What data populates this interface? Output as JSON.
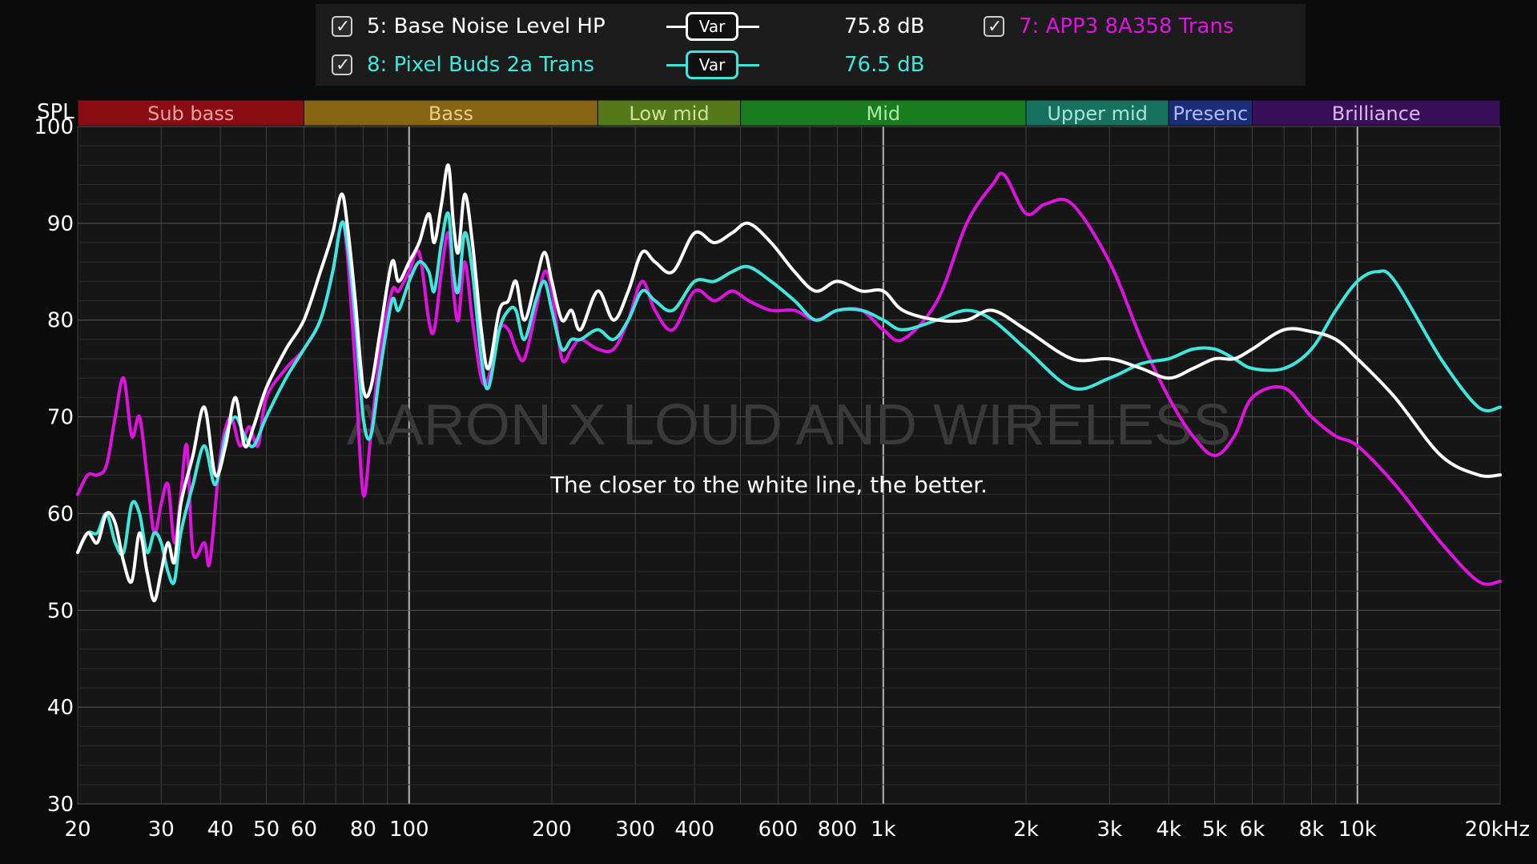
{
  "legend": {
    "entries": [
      {
        "label": "5: Base Noise Level HP",
        "value": "75.8 dB",
        "color": "#ffffff",
        "btn": "Var"
      },
      {
        "label": "8: Pixel Buds 2a Trans",
        "value": "76.5 dB",
        "color": "#3ee6dc",
        "btn": "Var"
      },
      {
        "label": "7: APP3 8A358 Trans",
        "color": "#e012e0"
      }
    ]
  },
  "bands": [
    {
      "label": "Sub bass",
      "from": 20,
      "to": 60,
      "color": "#8a0d14",
      "text": "#e7a1a6"
    },
    {
      "label": "Bass",
      "from": 60,
      "to": 250,
      "color": "#866414",
      "text": "#e6cf8a"
    },
    {
      "label": "Low mid",
      "from": 250,
      "to": 500,
      "color": "#55781a",
      "text": "#c8e39a"
    },
    {
      "label": "Mid",
      "from": 500,
      "to": 2000,
      "color": "#1a7d1f",
      "text": "#a9eaa9"
    },
    {
      "label": "Upper mid",
      "from": 2000,
      "to": 4000,
      "color": "#17715f",
      "text": "#a9e4d6"
    },
    {
      "label": "Presenc",
      "from": 4000,
      "to": 6000,
      "color": "#1b2c78",
      "text": "#b0bcf5"
    },
    {
      "label": "Brilliance",
      "from": 6000,
      "to": 20000,
      "color": "#3a0f5a",
      "text": "#d8b8f0"
    }
  ],
  "watermark": "AARON X LOUD AND WIRELESS",
  "annotation": "The closer to the white line, the better.",
  "chart_data": {
    "type": "line",
    "xscale": "log",
    "xlim": [
      20,
      20000
    ],
    "ylim": [
      30,
      100
    ],
    "ylabel": "SPL",
    "xunit": "Hz",
    "grid": true,
    "yticks": [
      30,
      40,
      50,
      60,
      70,
      80,
      90,
      100
    ],
    "xticks": [
      {
        "v": 20,
        "l": "20"
      },
      {
        "v": 30,
        "l": "30"
      },
      {
        "v": 40,
        "l": "40"
      },
      {
        "v": 50,
        "l": "50"
      },
      {
        "v": 60,
        "l": "60"
      },
      {
        "v": 80,
        "l": "80"
      },
      {
        "v": 100,
        "l": "100"
      },
      {
        "v": 200,
        "l": "200"
      },
      {
        "v": 300,
        "l": "300"
      },
      {
        "v": 400,
        "l": "400"
      },
      {
        "v": 600,
        "l": "600"
      },
      {
        "v": 800,
        "l": "800"
      },
      {
        "v": 1000,
        "l": "1k"
      },
      {
        "v": 2000,
        "l": "2k"
      },
      {
        "v": 3000,
        "l": "3k"
      },
      {
        "v": 4000,
        "l": "4k"
      },
      {
        "v": 5000,
        "l": "5k"
      },
      {
        "v": 6000,
        "l": "6k"
      },
      {
        "v": 8000,
        "l": "8k"
      },
      {
        "v": 10000,
        "l": "10k"
      },
      {
        "v": 20000,
        "l": "20kHz"
      }
    ],
    "series": [
      {
        "name": "5: Base Noise Level HP",
        "color": "#ffffff",
        "points": [
          [
            20,
            56
          ],
          [
            21,
            58
          ],
          [
            22,
            57
          ],
          [
            23,
            60
          ],
          [
            24,
            59
          ],
          [
            25,
            55
          ],
          [
            26,
            53
          ],
          [
            27,
            58
          ],
          [
            28,
            54
          ],
          [
            29,
            51
          ],
          [
            30,
            54
          ],
          [
            31,
            57
          ],
          [
            32,
            55
          ],
          [
            33,
            61
          ],
          [
            35,
            66
          ],
          [
            37,
            71
          ],
          [
            39,
            64
          ],
          [
            41,
            67
          ],
          [
            43,
            72
          ],
          [
            45,
            67
          ],
          [
            47,
            69
          ],
          [
            50,
            73
          ],
          [
            55,
            77
          ],
          [
            60,
            80
          ],
          [
            65,
            85
          ],
          [
            69,
            89
          ],
          [
            72,
            93
          ],
          [
            74,
            90
          ],
          [
            77,
            82
          ],
          [
            80,
            73
          ],
          [
            83,
            73
          ],
          [
            87,
            79
          ],
          [
            92,
            86
          ],
          [
            95,
            84
          ],
          [
            100,
            86
          ],
          [
            105,
            88
          ],
          [
            110,
            91
          ],
          [
            113,
            88
          ],
          [
            117,
            92
          ],
          [
            121,
            96
          ],
          [
            124,
            90
          ],
          [
            127,
            87
          ],
          [
            131,
            93
          ],
          [
            136,
            88
          ],
          [
            142,
            79
          ],
          [
            147,
            75
          ],
          [
            155,
            81
          ],
          [
            162,
            82
          ],
          [
            168,
            84
          ],
          [
            175,
            80
          ],
          [
            185,
            84
          ],
          [
            193,
            87
          ],
          [
            200,
            84
          ],
          [
            210,
            80
          ],
          [
            220,
            81
          ],
          [
            230,
            79
          ],
          [
            250,
            83
          ],
          [
            270,
            80
          ],
          [
            290,
            83
          ],
          [
            310,
            87
          ],
          [
            330,
            86
          ],
          [
            360,
            85
          ],
          [
            400,
            89
          ],
          [
            440,
            88
          ],
          [
            480,
            89
          ],
          [
            520,
            90
          ],
          [
            580,
            88
          ],
          [
            650,
            85
          ],
          [
            720,
            83
          ],
          [
            800,
            84
          ],
          [
            900,
            83
          ],
          [
            1000,
            83
          ],
          [
            1100,
            81
          ],
          [
            1300,
            80
          ],
          [
            1500,
            80
          ],
          [
            1700,
            81
          ],
          [
            2000,
            79
          ],
          [
            2500,
            76
          ],
          [
            3000,
            76
          ],
          [
            3500,
            75
          ],
          [
            4000,
            74
          ],
          [
            4500,
            75
          ],
          [
            5000,
            76
          ],
          [
            5500,
            76
          ],
          [
            6000,
            77
          ],
          [
            7000,
            79
          ],
          [
            8000,
            78.8
          ],
          [
            9000,
            78
          ],
          [
            10000,
            76
          ],
          [
            12000,
            72
          ],
          [
            15000,
            66
          ],
          [
            18000,
            64
          ],
          [
            20000,
            64
          ]
        ]
      },
      {
        "name": "8: Pixel Buds 2a Trans",
        "color": "#3ee6dc",
        "points": [
          [
            20,
            56
          ],
          [
            21,
            58
          ],
          [
            22,
            58
          ],
          [
            23,
            60
          ],
          [
            24,
            57
          ],
          [
            25,
            56
          ],
          [
            26,
            61
          ],
          [
            27,
            60
          ],
          [
            28,
            56
          ],
          [
            29,
            58
          ],
          [
            30,
            57
          ],
          [
            31,
            54
          ],
          [
            32,
            53
          ],
          [
            33,
            58
          ],
          [
            35,
            63
          ],
          [
            37,
            67
          ],
          [
            39,
            63
          ],
          [
            41,
            68
          ],
          [
            43,
            70
          ],
          [
            45,
            68
          ],
          [
            47,
            67
          ],
          [
            50,
            70
          ],
          [
            55,
            74
          ],
          [
            60,
            77
          ],
          [
            65,
            80
          ],
          [
            69,
            85
          ],
          [
            72,
            90
          ],
          [
            74,
            88
          ],
          [
            77,
            80
          ],
          [
            80,
            70
          ],
          [
            83,
            68
          ],
          [
            87,
            75
          ],
          [
            92,
            82
          ],
          [
            95,
            81
          ],
          [
            100,
            84
          ],
          [
            105,
            86
          ],
          [
            110,
            85
          ],
          [
            113,
            83
          ],
          [
            117,
            88
          ],
          [
            121,
            91
          ],
          [
            124,
            85
          ],
          [
            127,
            83
          ],
          [
            131,
            89
          ],
          [
            136,
            85
          ],
          [
            142,
            76
          ],
          [
            147,
            73
          ],
          [
            155,
            79
          ],
          [
            162,
            81
          ],
          [
            168,
            81
          ],
          [
            175,
            78
          ],
          [
            185,
            82
          ],
          [
            193,
            84
          ],
          [
            200,
            81
          ],
          [
            210,
            77
          ],
          [
            220,
            78
          ],
          [
            230,
            78
          ],
          [
            250,
            79
          ],
          [
            270,
            78
          ],
          [
            290,
            80
          ],
          [
            310,
            83
          ],
          [
            330,
            82
          ],
          [
            360,
            81
          ],
          [
            400,
            84
          ],
          [
            440,
            84
          ],
          [
            480,
            85
          ],
          [
            520,
            85.5
          ],
          [
            580,
            84
          ],
          [
            650,
            82
          ],
          [
            720,
            80
          ],
          [
            800,
            81
          ],
          [
            900,
            81
          ],
          [
            1000,
            80
          ],
          [
            1100,
            79
          ],
          [
            1300,
            80
          ],
          [
            1500,
            81
          ],
          [
            1700,
            80
          ],
          [
            2000,
            77
          ],
          [
            2500,
            73
          ],
          [
            3000,
            74
          ],
          [
            3500,
            75.5
          ],
          [
            4000,
            76
          ],
          [
            4500,
            77
          ],
          [
            5000,
            77
          ],
          [
            5500,
            76
          ],
          [
            6000,
            75
          ],
          [
            7000,
            75
          ],
          [
            8000,
            77
          ],
          [
            9000,
            81
          ],
          [
            10000,
            84
          ],
          [
            11000,
            85
          ],
          [
            12000,
            84
          ],
          [
            15000,
            76
          ],
          [
            18000,
            71
          ],
          [
            20000,
            71
          ]
        ]
      },
      {
        "name": "7: APP3 8A358 Trans",
        "color": "#e012e0",
        "points": [
          [
            20,
            62
          ],
          [
            21,
            64
          ],
          [
            22,
            64
          ],
          [
            23,
            65
          ],
          [
            24,
            70
          ],
          [
            25,
            74
          ],
          [
            26,
            68
          ],
          [
            27,
            70
          ],
          [
            28,
            64
          ],
          [
            29,
            58
          ],
          [
            30,
            61
          ],
          [
            31,
            63
          ],
          [
            32,
            57
          ],
          [
            33,
            62
          ],
          [
            34,
            67
          ],
          [
            35,
            56
          ],
          [
            37,
            57
          ],
          [
            38,
            55
          ],
          [
            40,
            66
          ],
          [
            42,
            70
          ],
          [
            44,
            67
          ],
          [
            46,
            69
          ],
          [
            48,
            67
          ],
          [
            50,
            72
          ],
          [
            55,
            75
          ],
          [
            60,
            77
          ],
          [
            65,
            80
          ],
          [
            69,
            85
          ],
          [
            72,
            90
          ],
          [
            74,
            87
          ],
          [
            77,
            75
          ],
          [
            80,
            62
          ],
          [
            83,
            68
          ],
          [
            87,
            77
          ],
          [
            92,
            83
          ],
          [
            95,
            83
          ],
          [
            100,
            85
          ],
          [
            105,
            87
          ],
          [
            110,
            80
          ],
          [
            113,
            79
          ],
          [
            117,
            85
          ],
          [
            121,
            89
          ],
          [
            124,
            83
          ],
          [
            127,
            80
          ],
          [
            131,
            86
          ],
          [
            136,
            80
          ],
          [
            142,
            74
          ],
          [
            147,
            74
          ],
          [
            155,
            79
          ],
          [
            162,
            79
          ],
          [
            168,
            77
          ],
          [
            175,
            76
          ],
          [
            185,
            81
          ],
          [
            193,
            85
          ],
          [
            200,
            83
          ],
          [
            210,
            76
          ],
          [
            220,
            77
          ],
          [
            230,
            78
          ],
          [
            250,
            77
          ],
          [
            270,
            77
          ],
          [
            290,
            80
          ],
          [
            310,
            84
          ],
          [
            330,
            81
          ],
          [
            360,
            79
          ],
          [
            400,
            83
          ],
          [
            440,
            82
          ],
          [
            480,
            83
          ],
          [
            520,
            82
          ],
          [
            580,
            81
          ],
          [
            650,
            81
          ],
          [
            720,
            80
          ],
          [
            800,
            81
          ],
          [
            900,
            81
          ],
          [
            1000,
            79
          ],
          [
            1100,
            78
          ],
          [
            1300,
            82
          ],
          [
            1500,
            90
          ],
          [
            1700,
            94
          ],
          [
            1800,
            95
          ],
          [
            2000,
            91
          ],
          [
            2200,
            92
          ],
          [
            2500,
            92
          ],
          [
            3000,
            86
          ],
          [
            3500,
            78
          ],
          [
            4000,
            72
          ],
          [
            4500,
            68
          ],
          [
            5000,
            66
          ],
          [
            5500,
            68
          ],
          [
            6000,
            72
          ],
          [
            7000,
            73
          ],
          [
            8000,
            70
          ],
          [
            9000,
            68
          ],
          [
            10000,
            67
          ],
          [
            12000,
            63
          ],
          [
            15000,
            57
          ],
          [
            18000,
            53
          ],
          [
            20000,
            53
          ]
        ]
      }
    ]
  }
}
